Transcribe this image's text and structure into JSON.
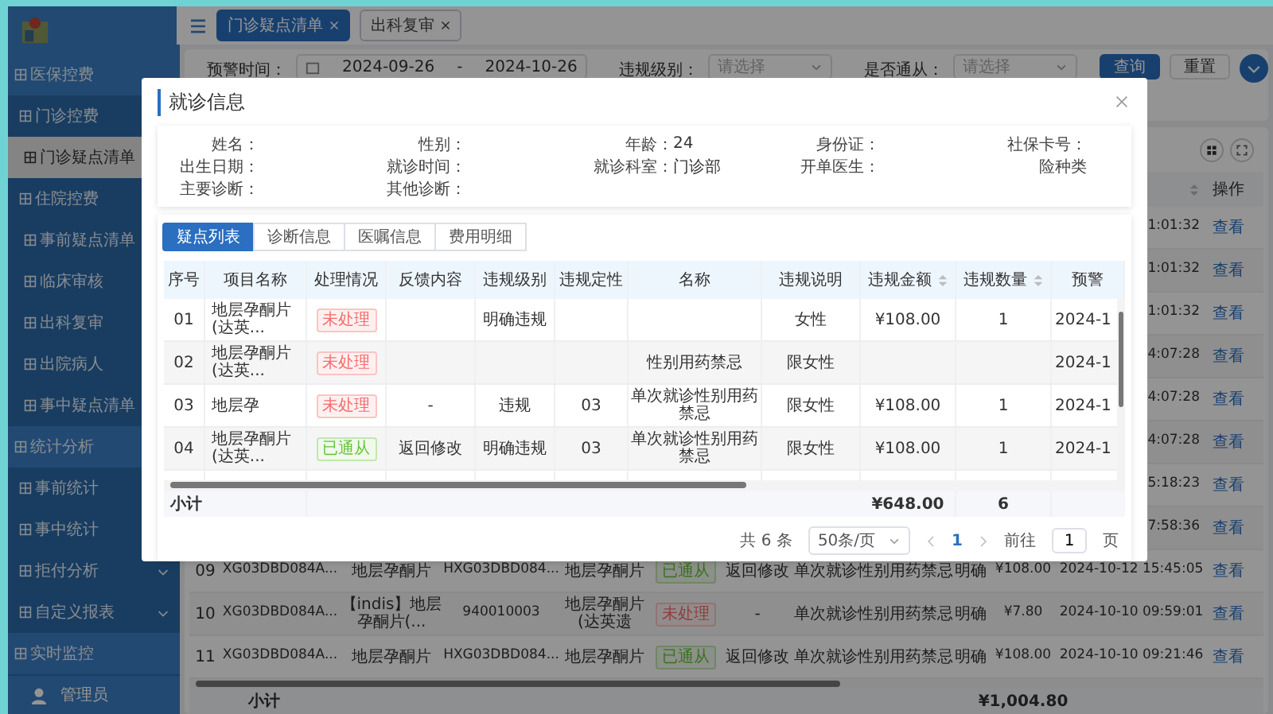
{
  "sidebar": {
    "items": [
      {
        "label": "医保控费",
        "selected": false,
        "children": [
          {
            "label": "门诊控费",
            "selected": false,
            "children": [
              {
                "label": "门诊疑点清单",
                "selected": true
              }
            ]
          },
          {
            "label": "住院控费",
            "selected": false,
            "children": [
              {
                "label": "事前疑点清单",
                "selected": false
              },
              {
                "label": "临床审核",
                "selected": false
              },
              {
                "label": "出科复审",
                "selected": false
              },
              {
                "label": "出院病人",
                "selected": false
              },
              {
                "label": "事中疑点清单",
                "selected": false
              }
            ]
          }
        ]
      },
      {
        "label": "统计分析",
        "selected": false,
        "children": [
          {
            "label": "事前统计",
            "selected": false
          },
          {
            "label": "事中统计",
            "selected": false
          },
          {
            "label": "拒付分析",
            "selected": false,
            "expanded": false
          },
          {
            "label": "自定义报表",
            "selected": false,
            "expanded": false
          }
        ]
      },
      {
        "label": "实时监控",
        "selected": false
      }
    ],
    "user": "管理员"
  },
  "top_tabs": [
    {
      "label": "门诊疑点清单",
      "selected": true
    },
    {
      "label": "出科复审",
      "selected": false
    }
  ],
  "filters": {
    "time_label": "预警时间：",
    "start": "2024-09-26",
    "separator": "-",
    "end": "2024-10-26",
    "level_label": "违规级别：",
    "level_placeholder": "请选择",
    "confirm_label": "是否通从：",
    "confirm_placeholder": "请选择",
    "query": "查询",
    "reset": "重置"
  },
  "main_table": {
    "action_header": "操作",
    "rows": [
      {
        "time": "1:01:32",
        "action": "查看"
      },
      {
        "time": "1:01:32",
        "action": "查看"
      },
      {
        "time": "1:01:32",
        "action": "查看"
      },
      {
        "time": "4:07:28",
        "action": "查看"
      },
      {
        "time": "4:07:28",
        "action": "查看"
      },
      {
        "time": "4:07:28",
        "action": "查看"
      },
      {
        "time": "5:18:23",
        "action": "查看"
      },
      {
        "time": "7:58:36",
        "action": "查看"
      },
      {
        "seq": "09",
        "code": "XG03DBD084A...",
        "item": "地层孕酮片",
        "code2": "HXG03DBD084...",
        "name": "地层孕酮片",
        "status": {
          "label": "已通从",
          "kind": "approved"
        },
        "feedback": "返回修改",
        "desc": "单次就诊性别用药禁忌",
        "rule": "明确",
        "amount": "¥108.00",
        "time": "2024-10-12 15:45:05",
        "action": "查看"
      },
      {
        "seq": "10",
        "code": "XG03DBD084A...",
        "item": "【indis】地层孕酮片(...",
        "code2": "940010003",
        "name": "地层孕酮片(达英遗",
        "status": {
          "label": "未处理",
          "kind": "pending"
        },
        "feedback": "-",
        "desc": "单次就诊性别用药禁忌",
        "rule": "明确",
        "amount": "¥7.80",
        "time": "2024-10-10 09:59:01",
        "action": "查看"
      },
      {
        "seq": "11",
        "code": "XG03DBD084A...",
        "item": "地层孕酮片",
        "code2": "HXG03DBD084...",
        "name": "地层孕酮片",
        "status": {
          "label": "已通从",
          "kind": "approved"
        },
        "feedback": "返回修改",
        "desc": "单次就诊性别用药禁忌",
        "rule": "明确",
        "amount": "¥108.00",
        "time": "2024-10-10 09:21:46",
        "action": "查看"
      }
    ],
    "subtotal_label": "小计",
    "subtotal_amount": "¥1,004.80"
  },
  "modal": {
    "title": "就诊信息",
    "info": [
      {
        "label": "姓名："
      },
      {
        "label": "性别："
      },
      {
        "label": "年龄：",
        "value": "24"
      },
      {
        "label": "身份证："
      },
      {
        "label": "社保卡号："
      },
      {
        "label": "出生日期："
      },
      {
        "label": "就诊时间："
      },
      {
        "label": "就诊科室：",
        "value": "门诊部"
      },
      {
        "label": "开单医生："
      },
      {
        "label": "险种类"
      },
      {
        "label": "主要诊断："
      },
      {
        "label": "其他诊断："
      }
    ],
    "tabs": [
      {
        "label": "疑点列表",
        "selected": true
      },
      {
        "label": "诊断信息",
        "selected": false
      },
      {
        "label": "医嘱信息",
        "selected": false
      },
      {
        "label": "费用明细",
        "selected": false
      }
    ],
    "columns": [
      {
        "label": "序号"
      },
      {
        "label": "项目名称"
      },
      {
        "label": "处理情况"
      },
      {
        "label": "反馈内容"
      },
      {
        "label": "违规级别"
      },
      {
        "label": "违规定性"
      },
      {
        "label": "名称"
      },
      {
        "label": "违规说明"
      },
      {
        "label": "违规金额",
        "sortable": true
      },
      {
        "label": "违规数量",
        "sortable": true
      },
      {
        "label": "预警"
      }
    ],
    "rows": [
      {
        "cells": [
          "01",
          "地层孕酮片(达英...",
          {
            "label": "未处理",
            "kind": "pending"
          },
          "",
          "明确违规",
          "",
          "",
          "女性",
          "¥108.00",
          "1",
          "2024-1"
        ]
      },
      {
        "cells": [
          "02",
          "地层孕酮片(达英...",
          {
            "label": "未处理",
            "kind": "pending"
          },
          "",
          "",
          "",
          "性别用药禁忌",
          "限女性",
          "",
          "",
          "2024-1"
        ]
      },
      {
        "cells": [
          "03",
          "地层孕",
          {
            "label": "未处理",
            "kind": "pending"
          },
          "-",
          "违规",
          "03",
          "单次就诊性别用药禁忌",
          "限女性",
          "¥108.00",
          "1",
          "2024-1"
        ]
      },
      {
        "cells": [
          "04",
          "地层孕酮片(达英...",
          {
            "label": "已通从",
            "kind": "approved"
          },
          "返回修改",
          "明确违规",
          "03",
          "单次就诊性别用药禁忌",
          "限女性",
          "¥108.00",
          "1",
          "2024-1"
        ]
      }
    ],
    "subtotal": {
      "label": "小计",
      "amount": "¥648.00",
      "count": "6"
    },
    "pagination": {
      "total": "共 6 条",
      "page_size": "50条/页",
      "pages": [
        {
          "label": "1",
          "selected": true
        }
      ],
      "goto_label": "前往",
      "goto_value": "1",
      "page_suffix": "页"
    }
  }
}
